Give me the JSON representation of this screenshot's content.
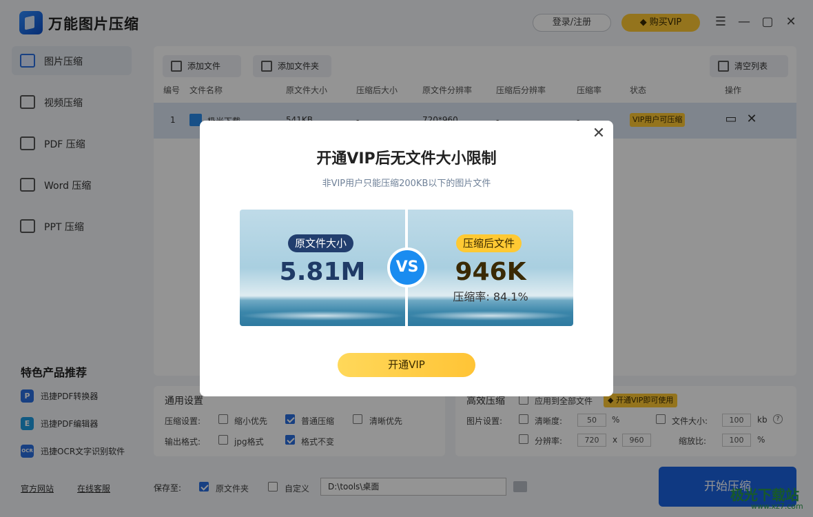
{
  "app": {
    "title": "万能图片压缩"
  },
  "header": {
    "login_label": "登录/注册",
    "vip_label": "购买VIP"
  },
  "sidebar": {
    "items": [
      {
        "label": "图片压缩"
      },
      {
        "label": "视频压缩"
      },
      {
        "label": "PDF 压缩"
      },
      {
        "label": "Word 压缩"
      },
      {
        "label": "PPT 压缩"
      }
    ],
    "recommend_title": "特色产品推荐",
    "recommend": [
      {
        "icon": "P",
        "label": "迅捷PDF转换器"
      },
      {
        "icon": "E",
        "label": "迅捷PDF编辑器"
      },
      {
        "icon": "OCR",
        "label": "迅捷OCR文字识别软件"
      }
    ],
    "footer_links": [
      "官方网站",
      "在线客服"
    ]
  },
  "toolbar": {
    "add_file": "添加文件",
    "add_folder": "添加文件夹",
    "clear_list": "清空列表"
  },
  "table": {
    "headers": [
      "编号",
      "文件名称",
      "原文件大小",
      "压缩后大小",
      "原文件分辨率",
      "压缩后分辨率",
      "压缩率",
      "状态",
      "操作"
    ],
    "rows": [
      {
        "index": "1",
        "name": "极光下载",
        "orig_size": "541KB",
        "new_size": "-",
        "orig_res": "720*960",
        "new_res": "-",
        "ratio": "-",
        "status": "VIP用户可压缩"
      }
    ]
  },
  "settings": {
    "general_title": "通用设置",
    "compress_label": "压缩设置:",
    "compress_options": [
      {
        "label": "缩小优先",
        "checked": false
      },
      {
        "label": "普通压缩",
        "checked": true
      },
      {
        "label": "清晰优先",
        "checked": false
      }
    ],
    "format_label": "输出格式:",
    "format_options": [
      {
        "label": "jpg格式",
        "checked": false
      },
      {
        "label": "格式不变",
        "checked": true
      }
    ],
    "advanced_title": "高效压缩",
    "apply_all": "应用到全部文件",
    "vip_tag": "开通VIP即可使用",
    "image_settings_label": "图片设置:",
    "clarity_label": "清晰度:",
    "clarity_value": "50",
    "clarity_unit": "%",
    "file_size_label": "文件大小:",
    "file_size_value": "100",
    "file_size_unit": "kb",
    "resolution_label": "分辨率:",
    "res_w": "720",
    "res_x": "x",
    "res_h": "960",
    "scale_label": "缩放比:",
    "scale_value": "100",
    "scale_unit": "%"
  },
  "save": {
    "label": "保存至:",
    "orig_folder": "原文件夹",
    "custom": "自定义",
    "path": "D:\\tools\\桌面",
    "orig_folder_checked": true,
    "custom_checked": false
  },
  "start_button": "开始压缩",
  "watermark": {
    "main": "极光下载站",
    "sub": "www.xz7.com"
  },
  "modal": {
    "title": "开通VIP后无文件大小限制",
    "subtitle": "非VIP用户只能压缩200KB以下的图片文件",
    "original_label": "原文件大小",
    "original_size": "5.81M",
    "vs": "VS",
    "compressed_label": "压缩后文件",
    "compressed_size": "946K",
    "rate_text": "压缩率: 84.1%",
    "open_button": "开通VIP"
  },
  "colors": {
    "accent": "#1a63e0",
    "vip": "#ffc933",
    "vs_circle": "#1a8cf0"
  }
}
